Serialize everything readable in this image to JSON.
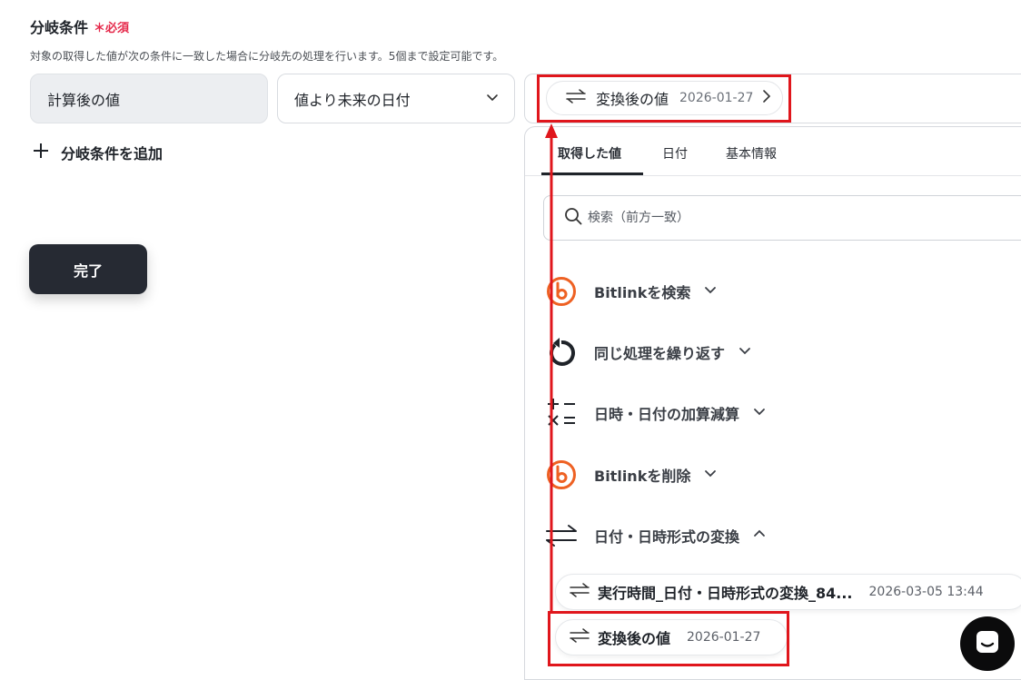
{
  "section": {
    "title": "分岐条件",
    "required_mark": "＊",
    "required_label": "必須",
    "description": "対象の取得した値が次の条件に一致した場合に分岐先の処理を行います。5個まで設定可能です。"
  },
  "condition": {
    "field_value": "計算後の値",
    "operator_value": "値より未来の日付",
    "chip": {
      "label": "変換後の値",
      "date": "2026-01-27"
    }
  },
  "add_condition_label": "分岐条件を追加",
  "done_label": "完了",
  "panel": {
    "tabs": [
      {
        "label": "取得した値",
        "active": true
      },
      {
        "label": "日付",
        "active": false
      },
      {
        "label": "基本情報",
        "active": false
      }
    ],
    "search_placeholder": "検索（前方一致）",
    "groups": [
      {
        "label": "Bitlinkを検索",
        "icon": "bitly-icon",
        "expanded": false
      },
      {
        "label": "同じ処理を繰り返す",
        "icon": "loop-icon",
        "expanded": false
      },
      {
        "label": "日時・日付の加算減算",
        "icon": "calc-icon",
        "expanded": false
      },
      {
        "label": "Bitlinkを削除",
        "icon": "bitly-icon",
        "expanded": false
      },
      {
        "label": "日付・日時形式の変換",
        "icon": "convert-icon",
        "expanded": true
      }
    ],
    "items": [
      {
        "label": "実行時間_日付・日時形式の変換_84...",
        "date": "2026-03-05 13:44"
      },
      {
        "label": "変換後の値",
        "date": "2026-01-27"
      }
    ]
  },
  "colors": {
    "accent_red": "#e0161c",
    "required_pink": "#e5284a",
    "bitly_orange": "#ee6123",
    "dark_button": "#262a33"
  }
}
